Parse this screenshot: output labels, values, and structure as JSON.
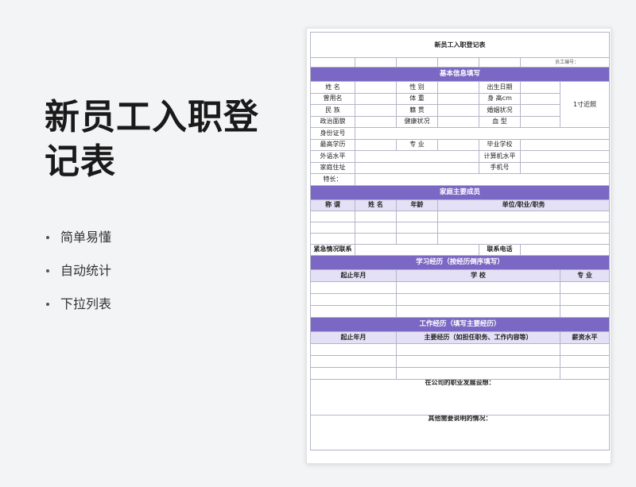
{
  "promo": {
    "title": "新员工入职登记表",
    "features": [
      "简单易懂",
      "自动统计",
      "下拉列表"
    ]
  },
  "form": {
    "title": "新员工入职登记表",
    "employee_no_label": "员工编号：",
    "basic": {
      "section": "基本信息填写",
      "name": "姓 名",
      "gender": "性 别",
      "birth": "出生日期",
      "former_name": "曾用名",
      "weight": "体 重",
      "height": "身 高cm",
      "ethnicity": "民 族",
      "native_place": "籍 贯",
      "marital": "婚姻状况",
      "photo": "1寸近照",
      "political": "政治面貌",
      "health": "健康状况",
      "blood": "血 型",
      "id_no": "身份证号",
      "education": "最高学历",
      "major": "专 业",
      "school": "毕业学校",
      "language": "外语水平",
      "computer": "计算机水平",
      "address": "家庭住址",
      "mobile": "手机号",
      "specialty": "特长："
    },
    "family": {
      "section": "家庭主要成员",
      "headers": [
        "称 谓",
        "姓 名",
        "年龄",
        "单位/职业/职务"
      ],
      "emergency_contact": "紧急情况联系",
      "contact_phone": "联系电话"
    },
    "study": {
      "section": "学习经历（按经历倒序填写）",
      "headers": [
        "起止年月",
        "学 校",
        "专 业"
      ]
    },
    "work": {
      "section": "工作经历（填写主要经历）",
      "headers": [
        "起止年月",
        "主要经历（如担任职务、工作内容等）",
        "薪资水平"
      ]
    },
    "career_plan": "在公司的职业发展设想：",
    "other_notes": "其他需要说明的情况："
  }
}
